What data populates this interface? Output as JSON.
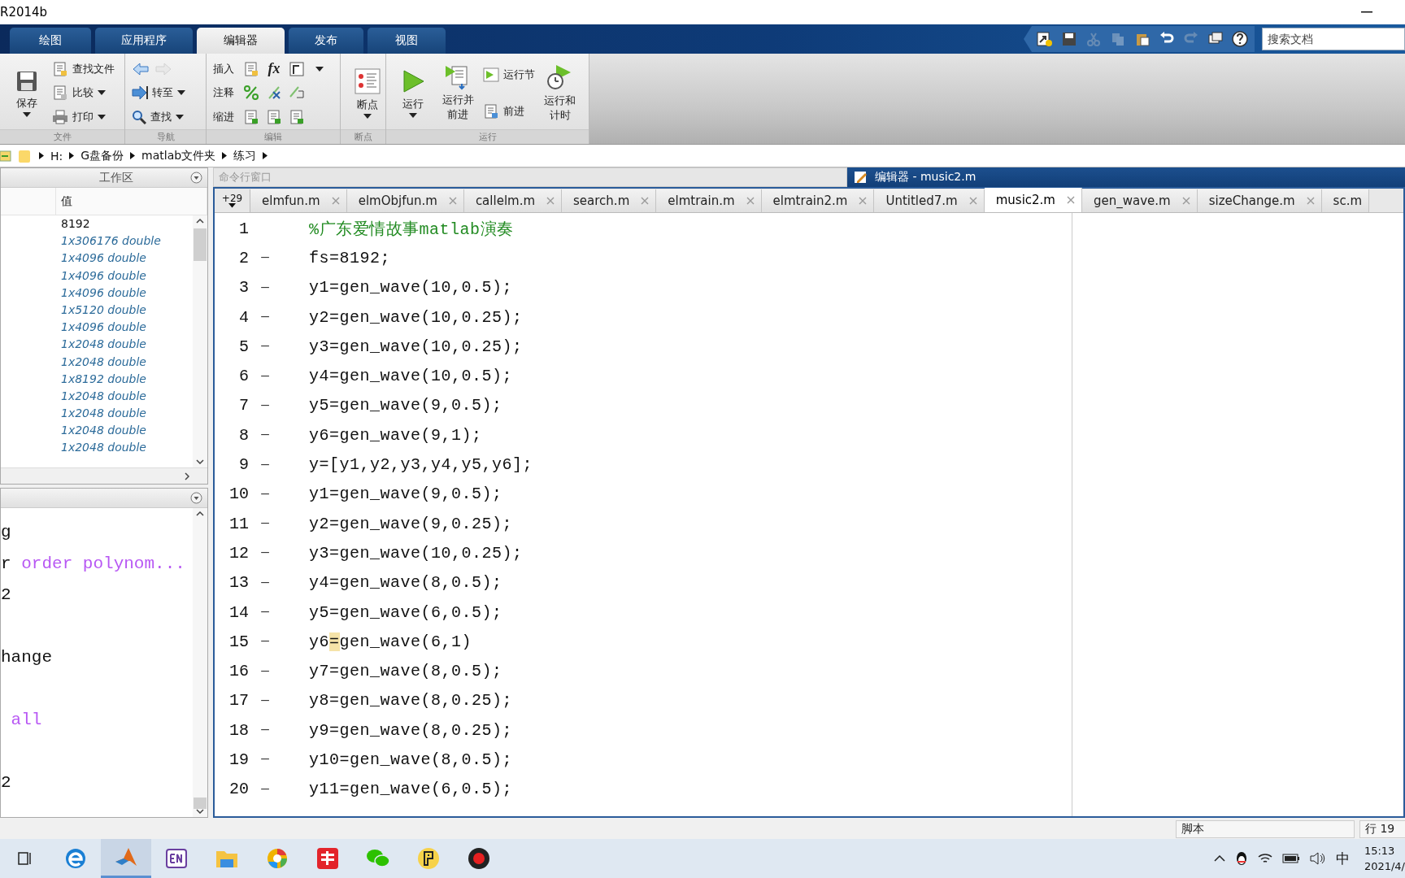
{
  "window": {
    "title": "R2014b"
  },
  "ribbon_tabs": [
    {
      "label": "绘图",
      "selected": false
    },
    {
      "label": "应用程序",
      "selected": false
    },
    {
      "label": "编辑器",
      "selected": true
    },
    {
      "label": "发布",
      "selected": false
    },
    {
      "label": "视图",
      "selected": false
    }
  ],
  "quick_access": [
    {
      "disabled": false
    },
    {
      "disabled": false
    },
    {
      "disabled": true
    },
    {
      "disabled": true
    },
    {
      "disabled": false
    },
    {
      "disabled": false
    },
    {
      "disabled": true
    },
    {
      "disabled": false
    },
    {
      "disabled": false
    }
  ],
  "search": {
    "placeholder": "搜索文档"
  },
  "ribbon_groups": [
    {
      "title": "文件",
      "columns": [
        [
          {
            "kind": "large",
            "label": "保存",
            "dropdown": true
          }
        ],
        [
          {
            "kind": "small",
            "label": "查找文件",
            "dropdown": false
          },
          {
            "kind": "small",
            "label": "比较",
            "dropdown": true
          },
          {
            "kind": "small",
            "label": "打印",
            "dropdown": true
          }
        ]
      ]
    },
    {
      "title": "导航",
      "columns": [
        [
          {
            "kind": "arrows",
            "forward_disabled": true
          },
          {
            "kind": "small",
            "label": "转至",
            "dropdown": true
          },
          {
            "kind": "small",
            "label": "查找",
            "dropdown": true
          }
        ]
      ]
    },
    {
      "title": "编辑",
      "columns": [
        [
          {
            "kind": "icon-row",
            "label": "插入",
            "dropdown": true,
            "symbol": "fx"
          },
          {
            "kind": "icon-row",
            "label": "注释",
            "dropdown": false
          },
          {
            "kind": "icon-row",
            "label": "缩进",
            "dropdown": false
          }
        ]
      ]
    },
    {
      "title": "断点",
      "columns": [
        [
          {
            "kind": "large",
            "label": "断点",
            "dropdown": true
          }
        ]
      ]
    },
    {
      "title": "运行",
      "columns": [
        [
          {
            "kind": "large",
            "label": "运行",
            "dropdown": true
          }
        ],
        [
          {
            "kind": "large",
            "label": "运行并前进",
            "dropdown": false
          }
        ],
        [
          {
            "kind": "small",
            "label": "运行节",
            "dropdown": false
          },
          {
            "kind": "small",
            "label": "前进",
            "dropdown": false
          }
        ],
        [
          {
            "kind": "large",
            "label": "运行和计时",
            "dropdown": false
          }
        ]
      ]
    }
  ],
  "path": [
    "H:",
    "G盘备份",
    "matlab文件夹",
    "练习"
  ],
  "workspace": {
    "title": "工作区",
    "value_header": "值",
    "rows": [
      {
        "value": "8192",
        "kind": "scalar"
      },
      {
        "value": "1x306176 double",
        "kind": "array"
      },
      {
        "value": "1x4096 double",
        "kind": "array"
      },
      {
        "value": "1x4096 double",
        "kind": "array"
      },
      {
        "value": "1x4096 double",
        "kind": "array"
      },
      {
        "value": "1x5120 double",
        "kind": "array"
      },
      {
        "value": "1x4096 double",
        "kind": "array"
      },
      {
        "value": "1x2048 double",
        "kind": "array"
      },
      {
        "value": "1x2048 double",
        "kind": "array"
      },
      {
        "value": "1x8192 double",
        "kind": "array"
      },
      {
        "value": "1x2048 double",
        "kind": "array"
      },
      {
        "value": "1x2048 double",
        "kind": "array"
      },
      {
        "value": "1x2048 double",
        "kind": "array"
      },
      {
        "value": "1x2048 double",
        "kind": "array"
      }
    ]
  },
  "history": [
    {
      "kind": "command",
      "segments": [
        {
          "text": "g",
          "kind": "plain"
        }
      ]
    },
    {
      "kind": "command",
      "segments": [
        {
          "text": "r ",
          "kind": "plain"
        },
        {
          "text": "order polynom...",
          "kind": "string"
        }
      ]
    },
    {
      "kind": "command",
      "segments": [
        {
          "text": "2",
          "kind": "plain"
        }
      ]
    },
    {
      "kind": "blank"
    },
    {
      "kind": "command",
      "segments": [
        {
          "text": "hange",
          "kind": "plain"
        }
      ]
    },
    {
      "kind": "blank"
    },
    {
      "kind": "command",
      "segments": [
        {
          "text": " all",
          "kind": "string"
        }
      ]
    },
    {
      "kind": "blank"
    },
    {
      "kind": "command",
      "segments": [
        {
          "text": "2",
          "kind": "plain"
        }
      ]
    }
  ],
  "command_window": {
    "title": "命令行窗口"
  },
  "editor": {
    "title": "编辑器 - music2.m",
    "hidden_count": "+29",
    "tabs": [
      {
        "label": "elmfun.m",
        "selected": false,
        "closable": true
      },
      {
        "label": "elmObjfun.m",
        "selected": false,
        "closable": true
      },
      {
        "label": "callelm.m",
        "selected": false,
        "closable": true
      },
      {
        "label": "search.m",
        "selected": false,
        "closable": true
      },
      {
        "label": "elmtrain.m",
        "selected": false,
        "closable": true
      },
      {
        "label": "elmtrain2.m",
        "selected": false,
        "closable": true
      },
      {
        "label": "Untitled7.m",
        "selected": false,
        "closable": true
      },
      {
        "label": "music2.m",
        "selected": true,
        "closable": true
      },
      {
        "label": "gen_wave.m",
        "selected": false,
        "closable": true
      },
      {
        "label": "sizeChange.m",
        "selected": false,
        "closable": true
      },
      {
        "label": "sc.m",
        "selected": false,
        "closable": false
      }
    ],
    "lines": [
      {
        "number": "1",
        "kind": "comment",
        "segments": [
          {
            "text": "%广东爱情故事matlab演奏",
            "highlighted": false
          }
        ]
      },
      {
        "number": "2",
        "marker": "—",
        "kind": "code",
        "segments": [
          {
            "text": "fs=8192;",
            "highlighted": false
          }
        ]
      },
      {
        "number": "3",
        "marker": "—",
        "kind": "code",
        "segments": [
          {
            "text": "y1=gen_wave(10,0.5);",
            "highlighted": false
          }
        ]
      },
      {
        "number": "4",
        "marker": "—",
        "kind": "code",
        "segments": [
          {
            "text": "y2=gen_wave(10,0.25);",
            "highlighted": false
          }
        ]
      },
      {
        "number": "5",
        "marker": "—",
        "kind": "code",
        "segments": [
          {
            "text": "y3=gen_wave(10,0.25);",
            "highlighted": false
          }
        ]
      },
      {
        "number": "6",
        "marker": "—",
        "kind": "code",
        "segments": [
          {
            "text": "y4=gen_wave(10,0.5);",
            "highlighted": false
          }
        ]
      },
      {
        "number": "7",
        "marker": "—",
        "kind": "code",
        "segments": [
          {
            "text": "y5=gen_wave(9,0.5);",
            "highlighted": false
          }
        ]
      },
      {
        "number": "8",
        "marker": "—",
        "kind": "code",
        "segments": [
          {
            "text": "y6=gen_wave(9,1);",
            "highlighted": false
          }
        ]
      },
      {
        "number": "9",
        "marker": "—",
        "kind": "code",
        "segments": [
          {
            "text": "y=[y1,y2,y3,y4,y5,y6];",
            "highlighted": false
          }
        ]
      },
      {
        "number": "10",
        "marker": "—",
        "kind": "code",
        "segments": [
          {
            "text": "y1=gen_wave(9,0.5);",
            "highlighted": false
          }
        ]
      },
      {
        "number": "11",
        "marker": "—",
        "kind": "code",
        "segments": [
          {
            "text": "y2=gen_wave(9,0.25);",
            "highlighted": false
          }
        ]
      },
      {
        "number": "12",
        "marker": "—",
        "kind": "code",
        "segments": [
          {
            "text": "y3=gen_wave(10,0.25);",
            "highlighted": false
          }
        ]
      },
      {
        "number": "13",
        "marker": "—",
        "kind": "code",
        "segments": [
          {
            "text": "y4=gen_wave(8,0.5);",
            "highlighted": false
          }
        ]
      },
      {
        "number": "14",
        "marker": "—",
        "kind": "code",
        "segments": [
          {
            "text": "y5=gen_wave(6,0.5);",
            "highlighted": false
          }
        ]
      },
      {
        "number": "15",
        "marker": "—",
        "kind": "code",
        "segments": [
          {
            "text": "y6",
            "highlighted": false
          },
          {
            "text": "=",
            "highlighted": true
          },
          {
            "text": "gen_wave(6,1)",
            "highlighted": false
          }
        ]
      },
      {
        "number": "16",
        "marker": "—",
        "kind": "code",
        "segments": [
          {
            "text": "y7=gen_wave(8,0.5);",
            "highlighted": false
          }
        ]
      },
      {
        "number": "17",
        "marker": "—",
        "kind": "code",
        "segments": [
          {
            "text": "y8=gen_wave(8,0.25);",
            "highlighted": false
          }
        ]
      },
      {
        "number": "18",
        "marker": "—",
        "kind": "code",
        "segments": [
          {
            "text": "y9=gen_wave(8,0.25);",
            "highlighted": false
          }
        ]
      },
      {
        "number": "19",
        "marker": "—",
        "kind": "code",
        "segments": [
          {
            "text": "y10=gen_wave(8,0.5);",
            "highlighted": false
          }
        ]
      },
      {
        "number": "20",
        "marker": "—",
        "kind": "code",
        "segments": [
          {
            "text": "y11=gen_wave(6,0.5);",
            "highlighted": false
          }
        ]
      }
    ]
  },
  "status_bar": {
    "mode": "脚本",
    "position": "行 19"
  },
  "taskbar": {
    "input_method": "中",
    "time": "15:13",
    "date": "2021/4/"
  }
}
